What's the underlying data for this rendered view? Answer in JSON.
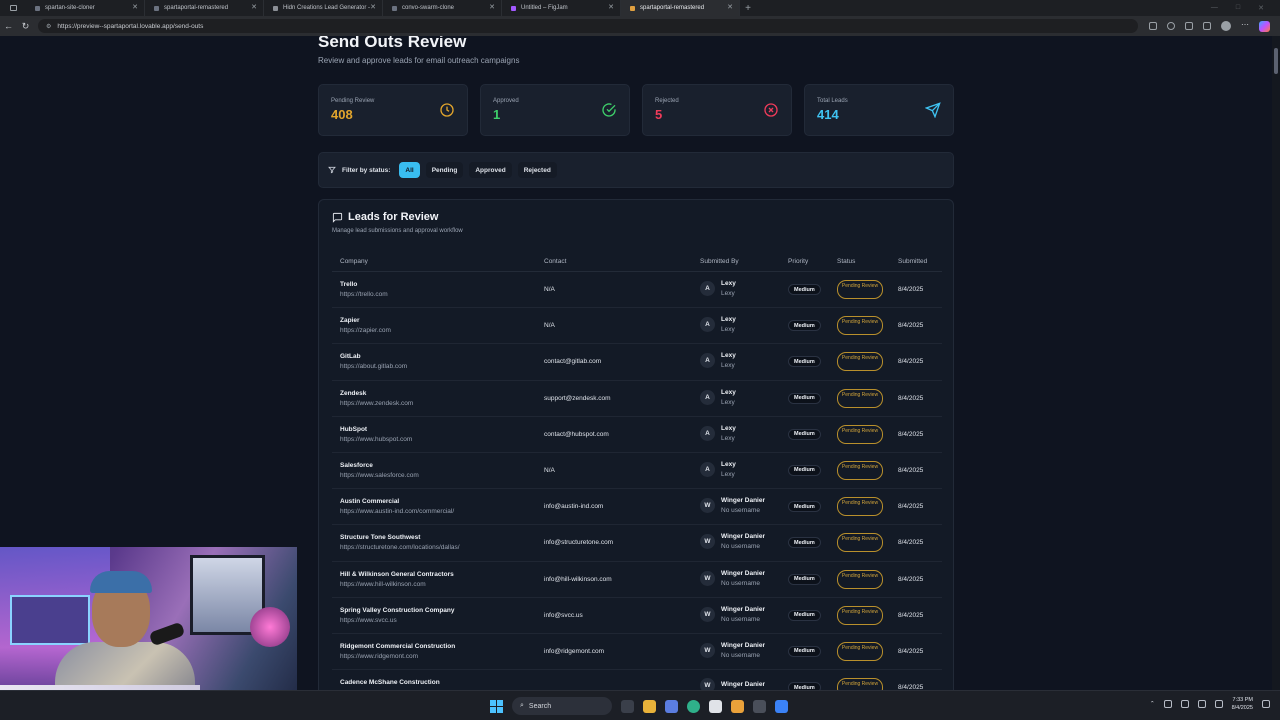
{
  "browser": {
    "tabs": [
      {
        "label": "spartan-site-cloner",
        "favicon_color": "#6b7280"
      },
      {
        "label": "spartaportal-remastered",
        "favicon_color": "#6b7280"
      },
      {
        "label": "Hidn Creations Lead Generator -",
        "favicon_color": "#8b8f96"
      },
      {
        "label": "convo-swarm-clone",
        "favicon_color": "#6b7280"
      },
      {
        "label": "Untitled – FigJam",
        "favicon_color": "#a259ff"
      },
      {
        "label": "spartaportal-remastered",
        "favicon_color": "#e0a040"
      }
    ],
    "active_tab": 5,
    "url": "https://preview--spartaportal.lovable.app/send-outs"
  },
  "page": {
    "title": "Send Outs Review",
    "subtitle": "Review and approve leads for email outreach campaigns"
  },
  "stats": [
    {
      "label": "Pending Review",
      "value": "408",
      "color": "#e2a52c",
      "icon": "clock-icon"
    },
    {
      "label": "Approved",
      "value": "1",
      "color": "#3ecf6a",
      "icon": "check-circle-icon"
    },
    {
      "label": "Rejected",
      "value": "5",
      "color": "#ef3b5a",
      "icon": "x-circle-icon"
    },
    {
      "label": "Total Leads",
      "value": "414",
      "color": "#3fc3f2",
      "icon": "send-icon"
    }
  ],
  "filter": {
    "label": "Filter by status:",
    "options": [
      "All",
      "Pending",
      "Approved",
      "Rejected"
    ],
    "active": "All"
  },
  "leads_panel": {
    "title": "Leads for Review",
    "subtitle": "Manage lead submissions and approval workflow",
    "columns": [
      "Company",
      "Contact",
      "Submitted By",
      "Priority",
      "Status",
      "Submitted"
    ],
    "rows": [
      {
        "company": "Trello",
        "url": "https://trello.com",
        "contact": "N/A",
        "initial": "A",
        "submitter": "Lexy",
        "username": "Lexy",
        "priority": "Medium",
        "status": "Pending Review",
        "date": "8/4/2025"
      },
      {
        "company": "Zapier",
        "url": "https://zapier.com",
        "contact": "N/A",
        "initial": "A",
        "submitter": "Lexy",
        "username": "Lexy",
        "priority": "Medium",
        "status": "Pending Review",
        "date": "8/4/2025"
      },
      {
        "company": "GitLab",
        "url": "https://about.gitlab.com",
        "contact": "contact@gitlab.com",
        "initial": "A",
        "submitter": "Lexy",
        "username": "Lexy",
        "priority": "Medium",
        "status": "Pending Review",
        "date": "8/4/2025"
      },
      {
        "company": "Zendesk",
        "url": "https://www.zendesk.com",
        "contact": "support@zendesk.com",
        "initial": "A",
        "submitter": "Lexy",
        "username": "Lexy",
        "priority": "Medium",
        "status": "Pending Review",
        "date": "8/4/2025"
      },
      {
        "company": "HubSpot",
        "url": "https://www.hubspot.com",
        "contact": "contact@hubspot.com",
        "initial": "A",
        "submitter": "Lexy",
        "username": "Lexy",
        "priority": "Medium",
        "status": "Pending Review",
        "date": "8/4/2025"
      },
      {
        "company": "Salesforce",
        "url": "https://www.salesforce.com",
        "contact": "N/A",
        "initial": "A",
        "submitter": "Lexy",
        "username": "Lexy",
        "priority": "Medium",
        "status": "Pending Review",
        "date": "8/4/2025"
      },
      {
        "company": "Austin Commercial",
        "url": "https://www.austin-ind.com/commercial/",
        "contact": "info@austin-ind.com",
        "initial": "W",
        "submitter": "Winger Danier",
        "username": "No username",
        "priority": "Medium",
        "status": "Pending Review",
        "date": "8/4/2025"
      },
      {
        "company": "Structure Tone Southwest",
        "url": "https://structuretone.com/locations/dallas/",
        "contact": "info@structuretone.com",
        "initial": "W",
        "submitter": "Winger Danier",
        "username": "No username",
        "priority": "Medium",
        "status": "Pending Review",
        "date": "8/4/2025"
      },
      {
        "company": "Hill & Wilkinson General Contractors",
        "url": "https://www.hill-wilkinson.com",
        "contact": "info@hill-wilkinson.com",
        "initial": "W",
        "submitter": "Winger Danier",
        "username": "No username",
        "priority": "Medium",
        "status": "Pending Review",
        "date": "8/4/2025"
      },
      {
        "company": "Spring Valley Construction Company",
        "url": "https://www.svcc.us",
        "contact": "info@svcc.us",
        "initial": "W",
        "submitter": "Winger Danier",
        "username": "No username",
        "priority": "Medium",
        "status": "Pending Review",
        "date": "8/4/2025"
      },
      {
        "company": "Ridgemont Commercial Construction",
        "url": "https://www.ridgemont.com",
        "contact": "info@ridgemont.com",
        "initial": "W",
        "submitter": "Winger Danier",
        "username": "No username",
        "priority": "Medium",
        "status": "Pending Review",
        "date": "8/4/2025"
      },
      {
        "company": "Cadence McShane Construction",
        "url": "",
        "contact": "",
        "initial": "W",
        "submitter": "Winger Danier",
        "username": "",
        "priority": "Medium",
        "status": "Pending Review",
        "date": "8/4/2025"
      }
    ]
  },
  "taskbar": {
    "search_placeholder": "Search",
    "time": "7:33 PM",
    "date": "8/4/2025"
  }
}
